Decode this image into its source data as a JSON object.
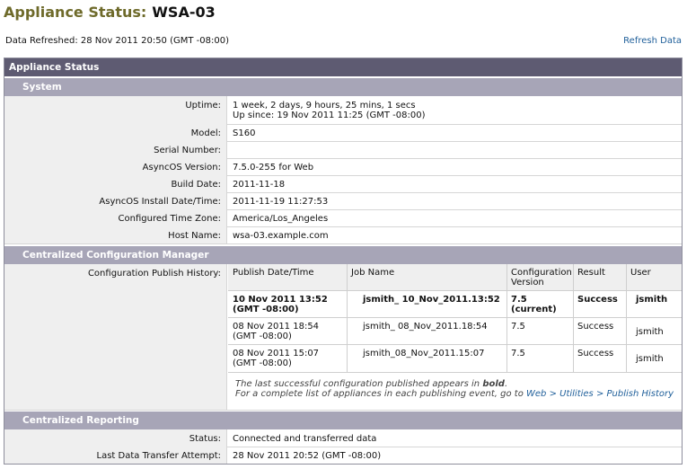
{
  "header": {
    "title_label": "Appliance Status:",
    "device_name": "WSA-03",
    "data_refreshed": "Data Refreshed: 28 Nov 2011 20:50 (GMT -08:00)",
    "refresh_link": "Refresh Data"
  },
  "panel": {
    "title": "Appliance Status",
    "system": {
      "title": "System",
      "rows": [
        {
          "label": "Uptime:",
          "value": "1 week, 2 days, 9 hours, 25 mins, 1 secs",
          "value2": "Up since: 19 Nov 2011 11:25 (GMT -08:00)"
        },
        {
          "label": "Model:",
          "value": "S160"
        },
        {
          "label": "Serial Number:",
          "value": ""
        },
        {
          "label": "AsyncOS Version:",
          "value": "7.5.0-255 for Web"
        },
        {
          "label": "Build Date:",
          "value": "2011-11-18"
        },
        {
          "label": "AsyncOS Install Date/Time:",
          "value": "2011-11-19 11:27:53"
        },
        {
          "label": "Configured Time Zone:",
          "value": "America/Los_Angeles"
        },
        {
          "label": "Host Name:",
          "value": "wsa-03.example.com"
        }
      ]
    },
    "ccm": {
      "title": "Centralized Configuration Manager",
      "history_label": "Configuration Publish History:",
      "columns": [
        "Publish Date/Time",
        "Job Name",
        "Configuration",
        "Result",
        "User"
      ],
      "columns_line2": [
        "",
        "",
        "Version",
        "",
        ""
      ],
      "rows": [
        {
          "date": "10 Nov 2011 13:52",
          "date2": "(GMT -08:00)",
          "job": "jsmith_ 10_Nov_2011.13:52",
          "version": "7.5",
          "version2": "(current)",
          "result": "Success",
          "user": "jsmith"
        },
        {
          "date": "08 Nov 2011 18:54",
          "date2": "(GMT -08:00)",
          "job": "jsmith_ 08_Nov_2011.18:54",
          "version": "7.5",
          "version2": "",
          "result": "Success",
          "user": "jsmith"
        },
        {
          "date": "08 Nov 2011 15:07",
          "date2": "(GMT -08:00)",
          "job": "jsmith_08_Nov_2011.15:07",
          "version": "7.5",
          "version2": "",
          "result": "Success",
          "user": "jsmith"
        }
      ],
      "note_line1_prefix": "The last successful configuration published appears in ",
      "note_line1_bold": "bold",
      "note_line1_suffix": ".",
      "note_line2_prefix": "For a complete list of appliances in each publishing event, go to ",
      "note_line2_link": "Web > Utilities > Publish History"
    },
    "reporting": {
      "title": "Centralized Reporting",
      "rows": [
        {
          "label": "Status:",
          "value": "Connected and transferred data"
        },
        {
          "label": "Last Data Transfer Attempt:",
          "value": "28 Nov 2011 20:52 (GMT -08:00)"
        }
      ]
    }
  }
}
